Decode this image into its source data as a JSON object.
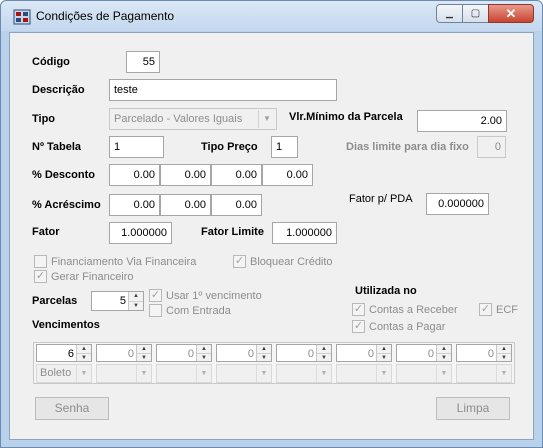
{
  "window": {
    "title": "Condições de Pagamento",
    "icon": "app-grid-icon",
    "minimize": "▁",
    "maximize": "▢",
    "close": "✕"
  },
  "form": {
    "codigo": {
      "label": "Código",
      "value": "55"
    },
    "descricao": {
      "label": "Descrição",
      "value": "teste"
    },
    "tipo": {
      "label": "Tipo",
      "value": "Parcelado - Valores Iguais"
    },
    "vlr_minimo": {
      "label": "Vlr.Mínimo da Parcela",
      "value": "2.00"
    },
    "tabela": {
      "label": "Nº Tabela",
      "value": "1"
    },
    "tipo_preco": {
      "label": "Tipo Preço",
      "value": "1"
    },
    "dias_limite": {
      "label": "Dias limite para dia fixo",
      "value": "0"
    },
    "desconto": {
      "label": "% Desconto",
      "values": [
        "0.00",
        "0.00",
        "0.00",
        "0.00"
      ]
    },
    "acrescimo": {
      "label": "% Acréscimo",
      "values": [
        "0.00",
        "0.00",
        "0.00"
      ]
    },
    "fator_pda": {
      "label": "Fator p/ PDA",
      "value": "0.000000"
    },
    "fator": {
      "label": "Fator",
      "value": "1.000000"
    },
    "fator_limite": {
      "label": "Fator Limite",
      "value": "1.000000"
    },
    "financiamento": {
      "label": "Financiamento Via Financeira",
      "checked": false
    },
    "bloquear_credito": {
      "label": "Bloquear Crédito",
      "checked": true
    },
    "gerar_financeiro": {
      "label": "Gerar Financeiro",
      "checked": true
    },
    "parcelas": {
      "label": "Parcelas",
      "value": "5"
    },
    "usar_vencimento": {
      "label": "Usar 1º vencimento",
      "checked": true
    },
    "com_entrada": {
      "label": "Com Entrada",
      "checked": false
    },
    "utilizada_no": {
      "label": "Utilizada no"
    },
    "contas_receber": {
      "label": "Contas a Receber",
      "checked": true
    },
    "ecf": {
      "label": "ECF",
      "checked": true
    },
    "contas_pagar": {
      "label": "Contas a Pagar",
      "checked": true
    },
    "vencimentos": {
      "label": "Vencimentos",
      "days": [
        "6",
        "0",
        "0",
        "0",
        "0",
        "0",
        "0",
        "0"
      ],
      "types": [
        "Boleto",
        "",
        "",
        "",
        "",
        "",
        "",
        ""
      ]
    }
  },
  "buttons": {
    "senha": "Senha",
    "limpa": "Limpa"
  },
  "glyphs": {
    "check": "✓",
    "dropdown": "▼",
    "up": "▲",
    "down": "▼"
  }
}
